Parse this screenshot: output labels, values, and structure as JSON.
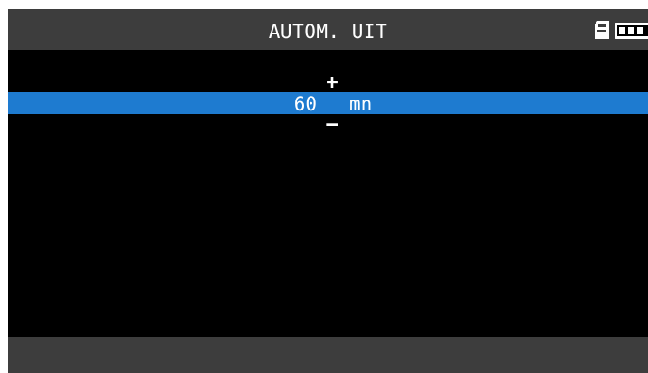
{
  "header": {
    "title": "AUTOM. UIT",
    "status_icons": [
      "sd-card-icon",
      "battery-icon"
    ]
  },
  "setting": {
    "increment_label": "+",
    "value": "60",
    "unit": "mn",
    "decrement_label": "–"
  },
  "colors": {
    "background": "#000000",
    "bars": "#3d3d3d",
    "selection": "#1e7bd0",
    "text": "#ffffff"
  }
}
